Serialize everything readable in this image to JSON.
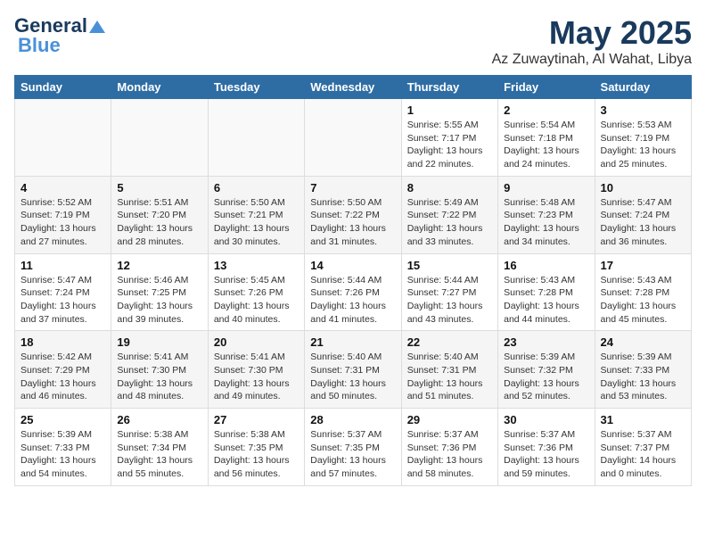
{
  "header": {
    "logo_general": "General",
    "logo_blue": "Blue",
    "month": "May 2025",
    "location": "Az Zuwaytinah, Al Wahat, Libya"
  },
  "days_of_week": [
    "Sunday",
    "Monday",
    "Tuesday",
    "Wednesday",
    "Thursday",
    "Friday",
    "Saturday"
  ],
  "weeks": [
    [
      {
        "day": "",
        "info": ""
      },
      {
        "day": "",
        "info": ""
      },
      {
        "day": "",
        "info": ""
      },
      {
        "day": "",
        "info": ""
      },
      {
        "day": "1",
        "info": "Sunrise: 5:55 AM\nSunset: 7:17 PM\nDaylight: 13 hours\nand 22 minutes."
      },
      {
        "day": "2",
        "info": "Sunrise: 5:54 AM\nSunset: 7:18 PM\nDaylight: 13 hours\nand 24 minutes."
      },
      {
        "day": "3",
        "info": "Sunrise: 5:53 AM\nSunset: 7:19 PM\nDaylight: 13 hours\nand 25 minutes."
      }
    ],
    [
      {
        "day": "4",
        "info": "Sunrise: 5:52 AM\nSunset: 7:19 PM\nDaylight: 13 hours\nand 27 minutes."
      },
      {
        "day": "5",
        "info": "Sunrise: 5:51 AM\nSunset: 7:20 PM\nDaylight: 13 hours\nand 28 minutes."
      },
      {
        "day": "6",
        "info": "Sunrise: 5:50 AM\nSunset: 7:21 PM\nDaylight: 13 hours\nand 30 minutes."
      },
      {
        "day": "7",
        "info": "Sunrise: 5:50 AM\nSunset: 7:22 PM\nDaylight: 13 hours\nand 31 minutes."
      },
      {
        "day": "8",
        "info": "Sunrise: 5:49 AM\nSunset: 7:22 PM\nDaylight: 13 hours\nand 33 minutes."
      },
      {
        "day": "9",
        "info": "Sunrise: 5:48 AM\nSunset: 7:23 PM\nDaylight: 13 hours\nand 34 minutes."
      },
      {
        "day": "10",
        "info": "Sunrise: 5:47 AM\nSunset: 7:24 PM\nDaylight: 13 hours\nand 36 minutes."
      }
    ],
    [
      {
        "day": "11",
        "info": "Sunrise: 5:47 AM\nSunset: 7:24 PM\nDaylight: 13 hours\nand 37 minutes."
      },
      {
        "day": "12",
        "info": "Sunrise: 5:46 AM\nSunset: 7:25 PM\nDaylight: 13 hours\nand 39 minutes."
      },
      {
        "day": "13",
        "info": "Sunrise: 5:45 AM\nSunset: 7:26 PM\nDaylight: 13 hours\nand 40 minutes."
      },
      {
        "day": "14",
        "info": "Sunrise: 5:44 AM\nSunset: 7:26 PM\nDaylight: 13 hours\nand 41 minutes."
      },
      {
        "day": "15",
        "info": "Sunrise: 5:44 AM\nSunset: 7:27 PM\nDaylight: 13 hours\nand 43 minutes."
      },
      {
        "day": "16",
        "info": "Sunrise: 5:43 AM\nSunset: 7:28 PM\nDaylight: 13 hours\nand 44 minutes."
      },
      {
        "day": "17",
        "info": "Sunrise: 5:43 AM\nSunset: 7:28 PM\nDaylight: 13 hours\nand 45 minutes."
      }
    ],
    [
      {
        "day": "18",
        "info": "Sunrise: 5:42 AM\nSunset: 7:29 PM\nDaylight: 13 hours\nand 46 minutes."
      },
      {
        "day": "19",
        "info": "Sunrise: 5:41 AM\nSunset: 7:30 PM\nDaylight: 13 hours\nand 48 minutes."
      },
      {
        "day": "20",
        "info": "Sunrise: 5:41 AM\nSunset: 7:30 PM\nDaylight: 13 hours\nand 49 minutes."
      },
      {
        "day": "21",
        "info": "Sunrise: 5:40 AM\nSunset: 7:31 PM\nDaylight: 13 hours\nand 50 minutes."
      },
      {
        "day": "22",
        "info": "Sunrise: 5:40 AM\nSunset: 7:31 PM\nDaylight: 13 hours\nand 51 minutes."
      },
      {
        "day": "23",
        "info": "Sunrise: 5:39 AM\nSunset: 7:32 PM\nDaylight: 13 hours\nand 52 minutes."
      },
      {
        "day": "24",
        "info": "Sunrise: 5:39 AM\nSunset: 7:33 PM\nDaylight: 13 hours\nand 53 minutes."
      }
    ],
    [
      {
        "day": "25",
        "info": "Sunrise: 5:39 AM\nSunset: 7:33 PM\nDaylight: 13 hours\nand 54 minutes."
      },
      {
        "day": "26",
        "info": "Sunrise: 5:38 AM\nSunset: 7:34 PM\nDaylight: 13 hours\nand 55 minutes."
      },
      {
        "day": "27",
        "info": "Sunrise: 5:38 AM\nSunset: 7:35 PM\nDaylight: 13 hours\nand 56 minutes."
      },
      {
        "day": "28",
        "info": "Sunrise: 5:37 AM\nSunset: 7:35 PM\nDaylight: 13 hours\nand 57 minutes."
      },
      {
        "day": "29",
        "info": "Sunrise: 5:37 AM\nSunset: 7:36 PM\nDaylight: 13 hours\nand 58 minutes."
      },
      {
        "day": "30",
        "info": "Sunrise: 5:37 AM\nSunset: 7:36 PM\nDaylight: 13 hours\nand 59 minutes."
      },
      {
        "day": "31",
        "info": "Sunrise: 5:37 AM\nSunset: 7:37 PM\nDaylight: 14 hours\nand 0 minutes."
      }
    ]
  ]
}
